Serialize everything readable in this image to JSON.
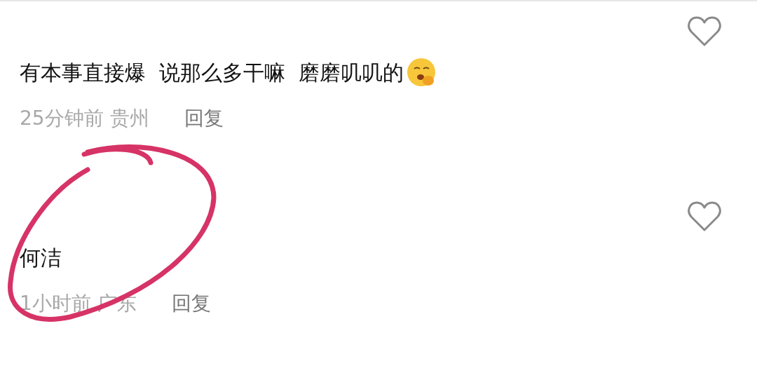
{
  "comments": [
    {
      "text": "有本事直接爆  说那么多干嘛  磨磨叽叽的",
      "emoji": true,
      "time": "25分钟前",
      "location": "贵州",
      "reply": "回复"
    },
    {
      "text": "何洁",
      "emoji": false,
      "time": "1小时前",
      "location": "广东",
      "reply": "回复"
    }
  ]
}
